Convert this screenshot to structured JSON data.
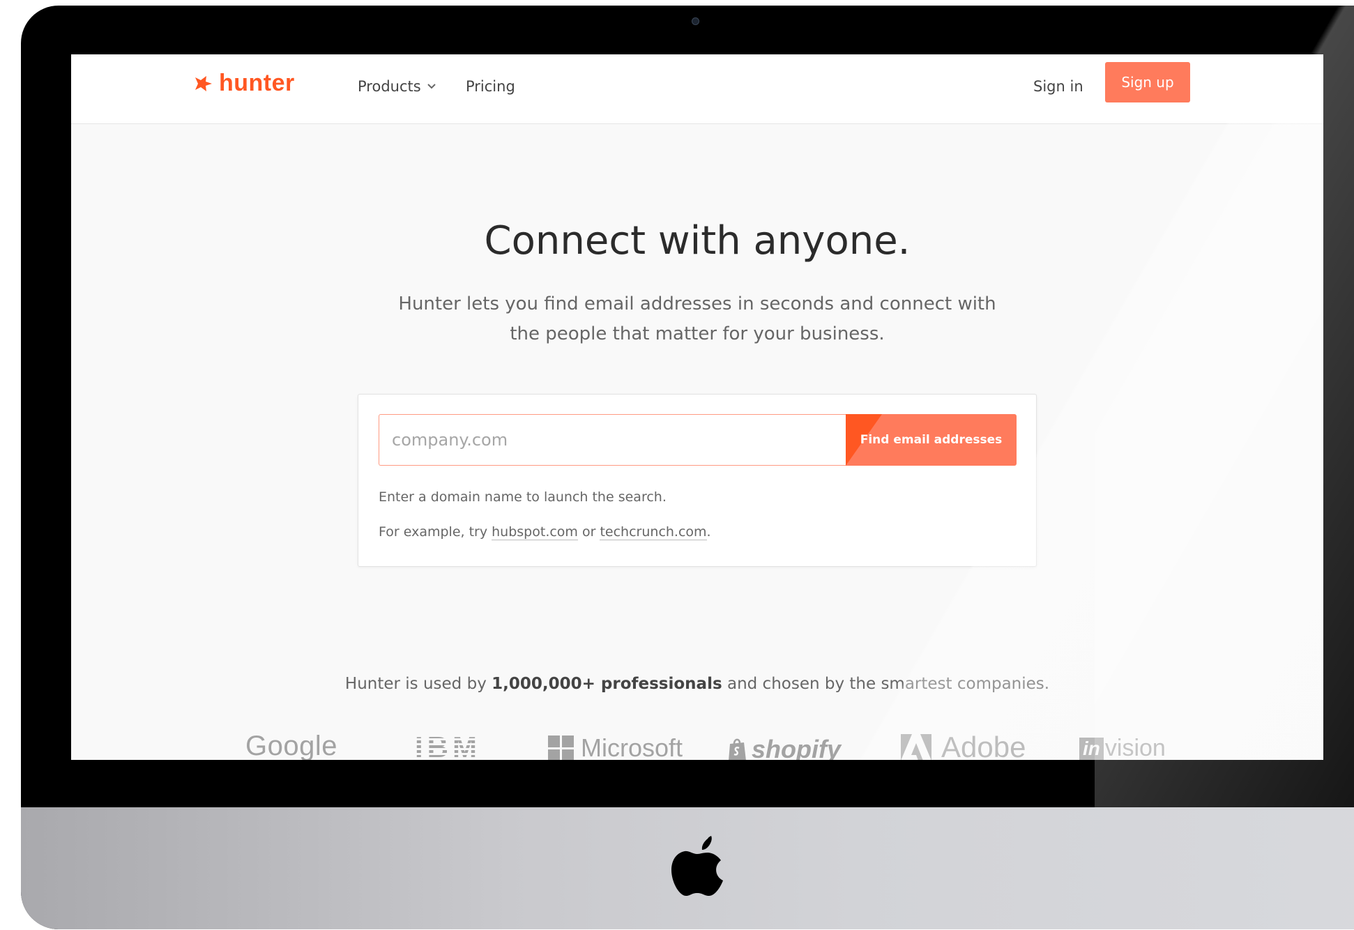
{
  "nav": {
    "logo_text": "hunter",
    "products_label": "Products",
    "pricing_label": "Pricing",
    "signin_label": "Sign in",
    "signup_label": "Sign up"
  },
  "hero": {
    "title": "Connect with anyone.",
    "subtitle": "Hunter lets you find email addresses in seconds and connect with the people that matter for your business."
  },
  "search": {
    "placeholder": "company.com",
    "value": "",
    "button_label": "Find email addresses",
    "hint": "Enter a domain name to launch the search.",
    "example_prefix": "For example, try",
    "example_link_1": "hubspot.com",
    "example_join": "or",
    "example_link_2": "techcrunch.com",
    "example_suffix": "."
  },
  "social_proof": {
    "text_before": "Hunter is used by",
    "highlight": "1,000,000+ professionals",
    "text_after": "and chosen by the smartest companies."
  },
  "companies": [
    {
      "name": "Google"
    },
    {
      "name": "IBM"
    },
    {
      "name": "Microsoft"
    },
    {
      "name": "shopify"
    },
    {
      "name": "Adobe"
    },
    {
      "name": "vision",
      "badge": "in"
    }
  ],
  "colors": {
    "brand": "#ff5722",
    "button": "#ff7b5c",
    "logo_grey": "#a3a3a3"
  },
  "icons": {
    "logo_mark": "hunter-fox-icon",
    "products_chevron": "chevron-down-icon",
    "device_logo": "apple-logo-icon"
  }
}
